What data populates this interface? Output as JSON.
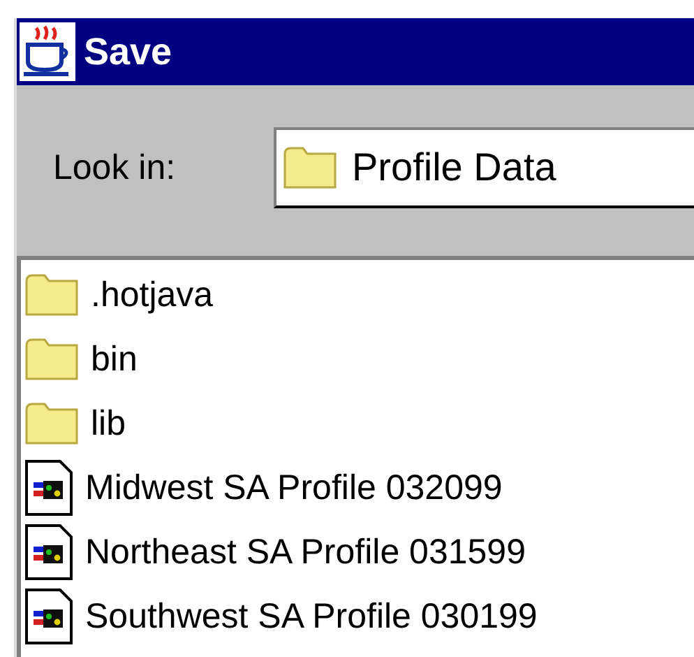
{
  "window": {
    "title": "Save"
  },
  "look_in": {
    "label": "Look in:",
    "value": "Profile Data"
  },
  "files": [
    {
      "name": ".hotjava",
      "kind": "folder"
    },
    {
      "name": "bin",
      "kind": "folder"
    },
    {
      "name": "lib",
      "kind": "folder"
    },
    {
      "name": "Midwest SA Profile 032099",
      "kind": "document"
    },
    {
      "name": "Northeast SA Profile 031599",
      "kind": "document"
    },
    {
      "name": "Southwest SA Profile 030199",
      "kind": "document"
    }
  ]
}
